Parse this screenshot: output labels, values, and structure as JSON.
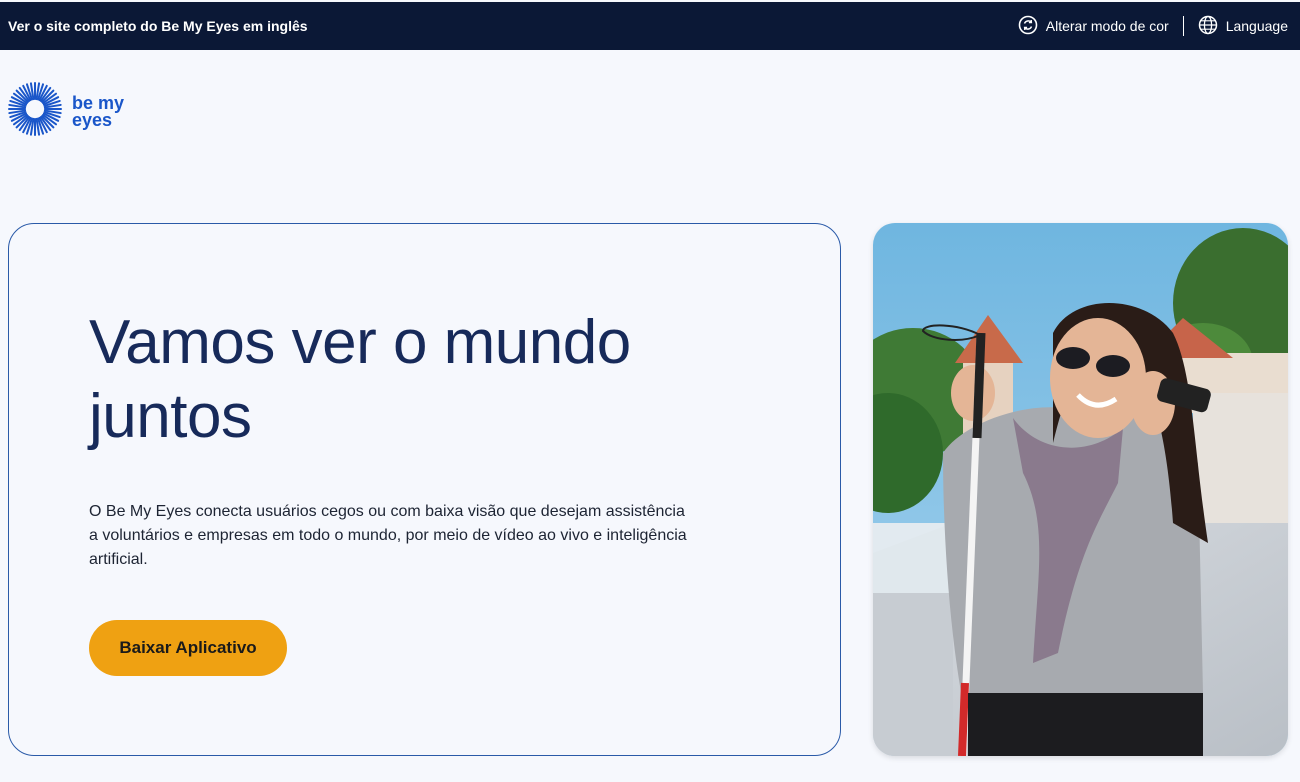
{
  "topbar": {
    "full_site_link": "Ver o site completo do Be My Eyes em inglês",
    "color_mode_label": "Alterar modo de cor",
    "language_label": "Language"
  },
  "logo": {
    "line1": "be my",
    "line2": "eyes"
  },
  "hero": {
    "title": "Vamos ver o mundo juntos",
    "description": "O Be My Eyes conecta usuários cegos ou com baixa visão que desejam assistência a voluntários e empresas em todo o mundo, por meio de vídeo ao vivo e inteligência artificial.",
    "cta_label": "Baixar Aplicativo"
  },
  "colors": {
    "topbar_bg": "#0b1836",
    "brand_blue": "#1a56c9",
    "title_navy": "#172a5a",
    "cta_orange": "#efa112"
  },
  "icons": {
    "color_mode": "color-mode-icon",
    "language": "globe-icon",
    "logo": "sunburst-logo-icon"
  }
}
